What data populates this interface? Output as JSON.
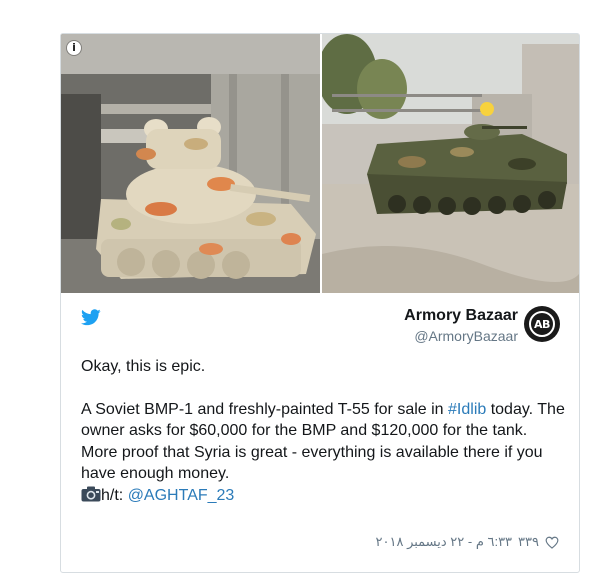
{
  "media": {
    "left_photo": "t55-tank-photo",
    "right_photo": "bmp1-photo",
    "info_icon": "info-icon",
    "info_glyph": "i"
  },
  "author": {
    "name": "Armory Bazaar",
    "handle": "@ArmoryBazaar",
    "avatar_text": "AB"
  },
  "tweet": {
    "line1": "Okay, this is epic.",
    "para2_pre": "A Soviet BMP-1 and freshly-painted T-55 for sale in ",
    "hashtag": "#Idlib",
    "para2_post": " today. The owner asks for $60,000 for the BMP and $120,000 for the tank.",
    "para3": "More proof that Syria is great - everything is available there if you have enough money.",
    "ht_label": "h/t: ",
    "ht_mention": "@AGHTAF_23"
  },
  "footer": {
    "likes": "٣٣٩",
    "timestamp": "٦:٣٣ م - ٢٢ ديسمبر ٢٠١٨"
  },
  "colors": {
    "twitter_blue": "#1da1f2",
    "link_blue": "#2b7bb9",
    "muted": "#657786"
  }
}
